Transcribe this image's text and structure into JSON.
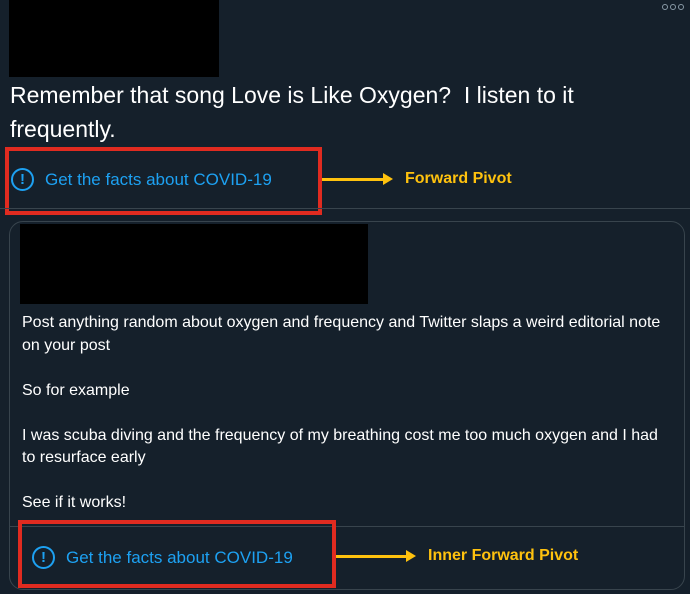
{
  "tweet": {
    "text": "Remember that song Love is Like Oxygen?  I listen to it frequently.",
    "facts_label": "Get the facts about COVID-19",
    "annotation": "Forward Pivot"
  },
  "quoted_tweet": {
    "text": "Post anything random about oxygen and frequency and Twitter slaps a weird editorial note on your post\n\nSo for example\n\nI was scuba diving and the frequency of my breathing cost me too much oxygen and I had to resurface early\n\nSee if it works!",
    "facts_label": "Get the facts about COVID-19",
    "annotation": "Inner Forward Pivot"
  },
  "icons": {
    "warning": "!"
  },
  "colors": {
    "background": "#15202b",
    "link": "#1da1f2",
    "highlight_box": "#e02b20",
    "annotation": "#ffc20e"
  }
}
